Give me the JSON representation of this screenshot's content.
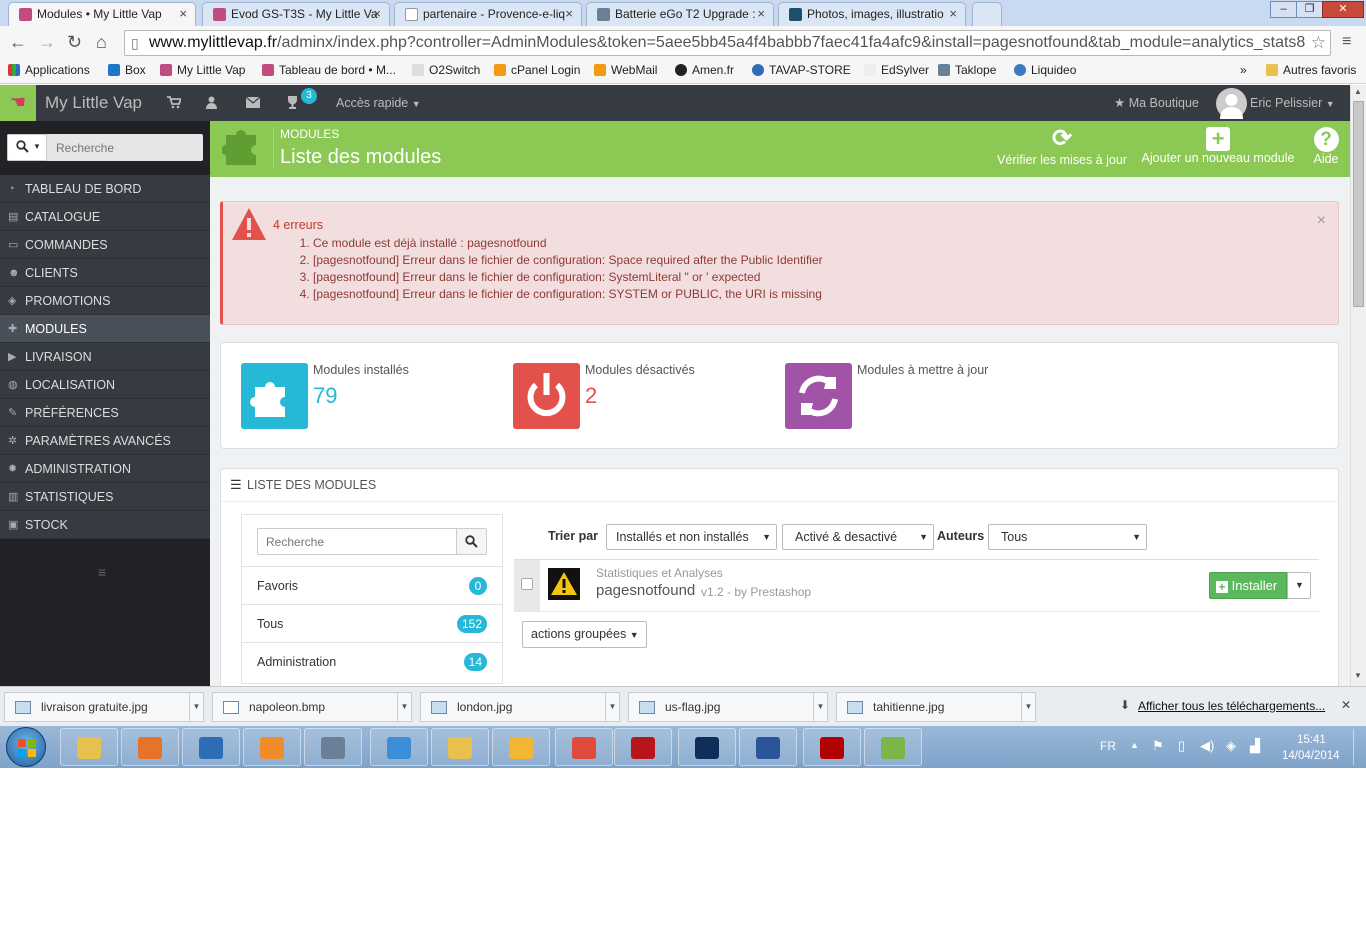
{
  "browser": {
    "tabs": [
      {
        "title": "Modules • My Little Vap",
        "icon": "prestashop-icon",
        "active": true
      },
      {
        "title": "Evod GS-T3S - My Little Va",
        "icon": "prestashop-icon",
        "active": false
      },
      {
        "title": "partenaire - Provence-e-liq",
        "icon": "document-icon",
        "active": false
      },
      {
        "title": "Batterie eGo T2 Upgrade :",
        "icon": "tk-icon",
        "active": false
      },
      {
        "title": "Photos, images, illustratio",
        "icon": "camera-icon",
        "active": false
      }
    ],
    "window_controls": {
      "minimize": "–",
      "maximize": "❐",
      "close": "✕"
    },
    "url_host": "www.mylittlevap.fr",
    "url_path": "/adminx/index.php?controller=AdminModules&token=5aee5bb45a4f4babbb7faec41fa4afc9&install=pagesnotfound&tab_module=analytics_stats8",
    "bookmarks": [
      "Applications",
      "Box",
      "My Little Vap",
      "Tableau de bord • M...",
      "O2Switch",
      "cPanel Login",
      "WebMail",
      "Amen.fr",
      "TAVAP-STORE",
      "EdSylver",
      "Taklope",
      "Liquideo"
    ],
    "bookmarks_more": "»",
    "other_bookmarks": "Autres favoris"
  },
  "admin_header": {
    "brand": "My Little Vap",
    "notification_count": "3",
    "quick_access": "Accès rapide",
    "my_shop": "Ma Boutique",
    "user": "Eric Pelissier"
  },
  "sidebar": {
    "search_placeholder": "Recherche",
    "items": [
      {
        "label": "TABLEAU DE BORD",
        "icon": "dashboard-icon"
      },
      {
        "label": "CATALOGUE",
        "icon": "book-icon"
      },
      {
        "label": "COMMANDES",
        "icon": "credit-card-icon"
      },
      {
        "label": "CLIENTS",
        "icon": "users-icon"
      },
      {
        "label": "PROMOTIONS",
        "icon": "tags-icon"
      },
      {
        "label": "MODULES",
        "icon": "puzzle-icon",
        "active": true
      },
      {
        "label": "LIVRAISON",
        "icon": "truck-icon"
      },
      {
        "label": "LOCALISATION",
        "icon": "globe-icon"
      },
      {
        "label": "PRÉFÉRENCES",
        "icon": "wrench-icon"
      },
      {
        "label": "PARAMÈTRES AVANCÉS",
        "icon": "cogs-icon"
      },
      {
        "label": "ADMINISTRATION",
        "icon": "cog-icon"
      },
      {
        "label": "STATISTIQUES",
        "icon": "bar-chart-icon"
      },
      {
        "label": "STOCK",
        "icon": "archive-icon"
      }
    ]
  },
  "page_header": {
    "breadcrumb": "MODULES",
    "title": "Liste des modules",
    "toolbar": [
      {
        "label": "Vérifier les mises à jour",
        "icon": "refresh-icon"
      },
      {
        "label": "Ajouter un nouveau module",
        "icon": "plus-icon"
      },
      {
        "label": "Aide",
        "icon": "help-icon"
      }
    ]
  },
  "error_alert": {
    "heading": "4 erreurs",
    "errors": [
      "Ce module est déjà installé : pagesnotfound",
      "[pagesnotfound] Erreur dans le fichier de configuration: Space required after the Public Identifier",
      "[pagesnotfound] Erreur dans le fichier de configuration: SystemLiteral \" or ' expected",
      "[pagesnotfound] Erreur dans le fichier de configuration: SYSTEM or PUBLIC, the URI is missing"
    ],
    "close": "×"
  },
  "kpis": [
    {
      "label": "Modules installés",
      "value": "79",
      "color": "#25b9d7"
    },
    {
      "label": "Modules désactivés",
      "value": "2",
      "color": "#e3514c"
    },
    {
      "label": "Modules à mettre à jour",
      "value": "",
      "color": "#a153a8"
    }
  ],
  "module_list": {
    "title": "LISTE DES MODULES",
    "search_placeholder": "Recherche",
    "categories": [
      {
        "label": "Favoris",
        "count": "0"
      },
      {
        "label": "Tous",
        "count": "152"
      },
      {
        "label": "Administration",
        "count": "14"
      }
    ],
    "sort_label": "Trier par",
    "filter_install": "Installés et non installés",
    "filter_status": "Activé & desactivé",
    "authors_label": "Auteurs",
    "filter_author": "Tous",
    "modules": [
      {
        "category": "Statistiques et Analyses",
        "name": "pagesnotfound",
        "meta": "v1.2 - by Prestashop",
        "action": "Installer"
      }
    ],
    "bulk_actions": "actions groupées"
  },
  "downloads": {
    "items": [
      "livraison gratuite.jpg",
      "napoleon.bmp",
      "london.jpg",
      "us-flag.jpg",
      "tahitienne.jpg"
    ],
    "show_all": "Afficher tous les téléchargements...",
    "close": "✕"
  },
  "taskbar": {
    "apps": [
      "explorer-icon",
      "firefox-icon",
      "thunderbird-icon",
      "media-player-icon",
      "security-icon",
      "internet-explorer-icon",
      "outlook-icon",
      "tools-icon",
      "chrome-icon",
      "acrobat-icon",
      "photoshop-icon",
      "word-icon",
      "filezilla-icon",
      "notepad-plus-icon"
    ],
    "lang": "FR",
    "time": "15:41",
    "date": "14/04/2014"
  }
}
